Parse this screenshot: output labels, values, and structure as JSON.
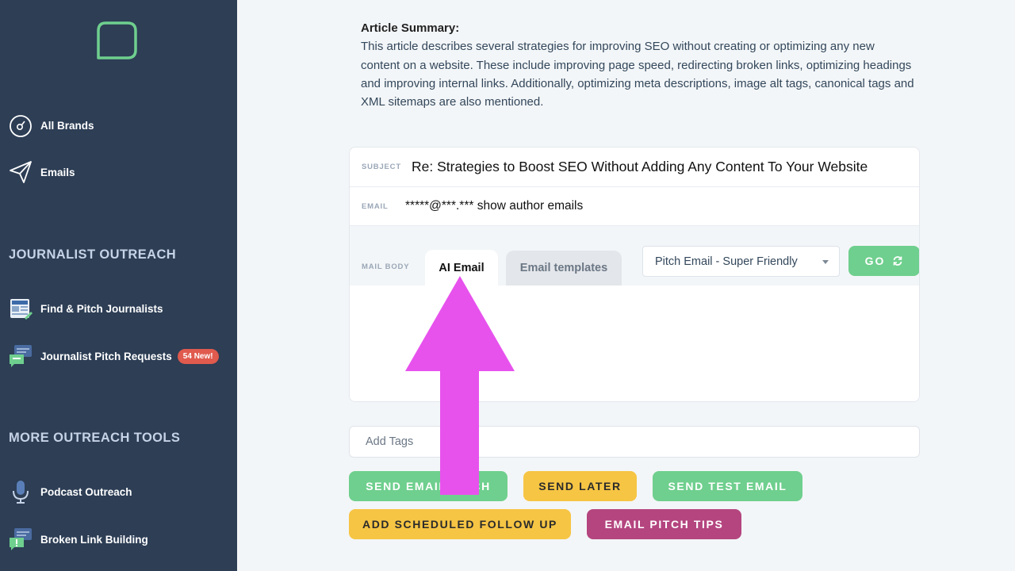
{
  "sidebar": {
    "items": [
      {
        "label": "All Brands",
        "icon": "compass-icon"
      },
      {
        "label": "Emails",
        "icon": "paper-plane-icon"
      }
    ],
    "journalist_outreach": {
      "title": "JOURNALIST OUTREACH",
      "items": [
        {
          "label": "Find & Pitch Journalists",
          "icon": "news-icon"
        },
        {
          "label": "Journalist Pitch Requests",
          "icon": "chat-bubble-icon",
          "badge": "54 New!"
        }
      ]
    },
    "more_tools": {
      "title": "MORE OUTREACH TOOLS",
      "items": [
        {
          "label": "Podcast Outreach",
          "icon": "microphone-icon"
        },
        {
          "label": "Broken Link Building",
          "icon": "alert-chat-icon"
        }
      ]
    }
  },
  "summary": {
    "title": "Article Summary:",
    "text": "This article describes several strategies for improving SEO without creating or optimizing any new content on a website. These include improving page speed, redirecting broken links, optimizing headings and improving internal links. Additionally, optimizing meta descriptions, image alt tags, canonical tags and XML sitemaps are also mentioned."
  },
  "compose": {
    "subject_label": "SUBJECT",
    "subject_value": "Re: Strategies to Boost SEO Without Adding Any Content To Your Website",
    "email_label": "EMAIL",
    "email_masked": "*****@***.***",
    "email_link": "show author emails",
    "mail_body_label": "MAIL BODY",
    "tabs": [
      "AI Email",
      "Email templates"
    ],
    "template_select": "Pitch Email - Super Friendly",
    "go_label": "GO"
  },
  "tags": {
    "placeholder": "Add Tags"
  },
  "actions": {
    "send_email_pitch": "SEND EMAIL PITCH",
    "send_later": "SEND LATER",
    "send_test_email": "SEND TEST EMAIL",
    "add_follow_up": "ADD SCHEDULED FOLLOW UP",
    "email_pitch_tips": "EMAIL PITCH TIPS"
  },
  "colors": {
    "sidebar_bg": "#2d3e55",
    "accent_green": "#6fcf8e",
    "accent_yellow": "#f6c544",
    "accent_purple": "#b4457f",
    "badge_red": "#e05a4e",
    "annotation_arrow": "#e752ed"
  }
}
